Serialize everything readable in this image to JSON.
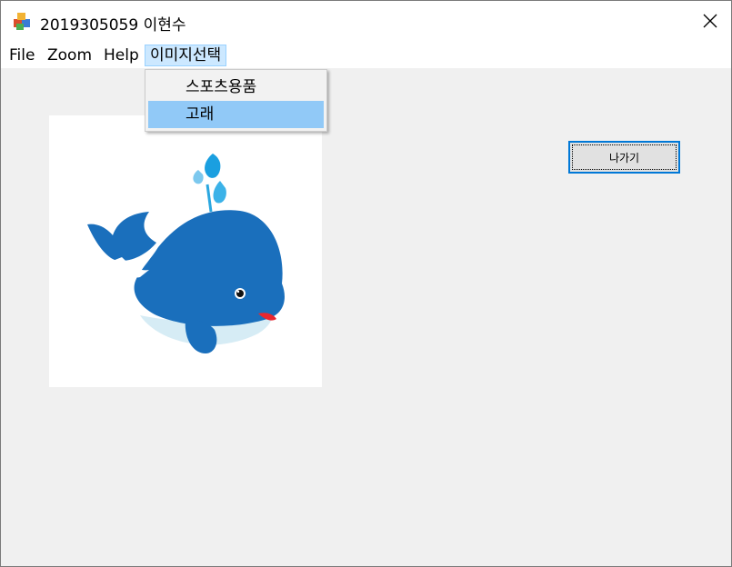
{
  "window": {
    "title": "2019305059 이현수",
    "app_icon": "form-app-icon",
    "close_icon": "close-icon"
  },
  "menubar": {
    "items": [
      {
        "label": "File"
      },
      {
        "label": "Zoom"
      },
      {
        "label": "Help"
      },
      {
        "label": "이미지선택",
        "open": true
      }
    ]
  },
  "dropdown": {
    "items": [
      {
        "label": "스포츠용품",
        "highlighted": false
      },
      {
        "label": "고래",
        "highlighted": true
      }
    ]
  },
  "image": {
    "subject": "whale-illustration",
    "colors": {
      "body": "#1a6fbc",
      "belly": "#d6ecf5",
      "water": "#2aa7e0",
      "tongue": "#e8262f"
    }
  },
  "buttons": {
    "exit_label": "나가기"
  },
  "colors": {
    "menu_highlight": "#cce8ff",
    "dropdown_highlight": "#91c9f7",
    "focus_border": "#0078d7"
  }
}
